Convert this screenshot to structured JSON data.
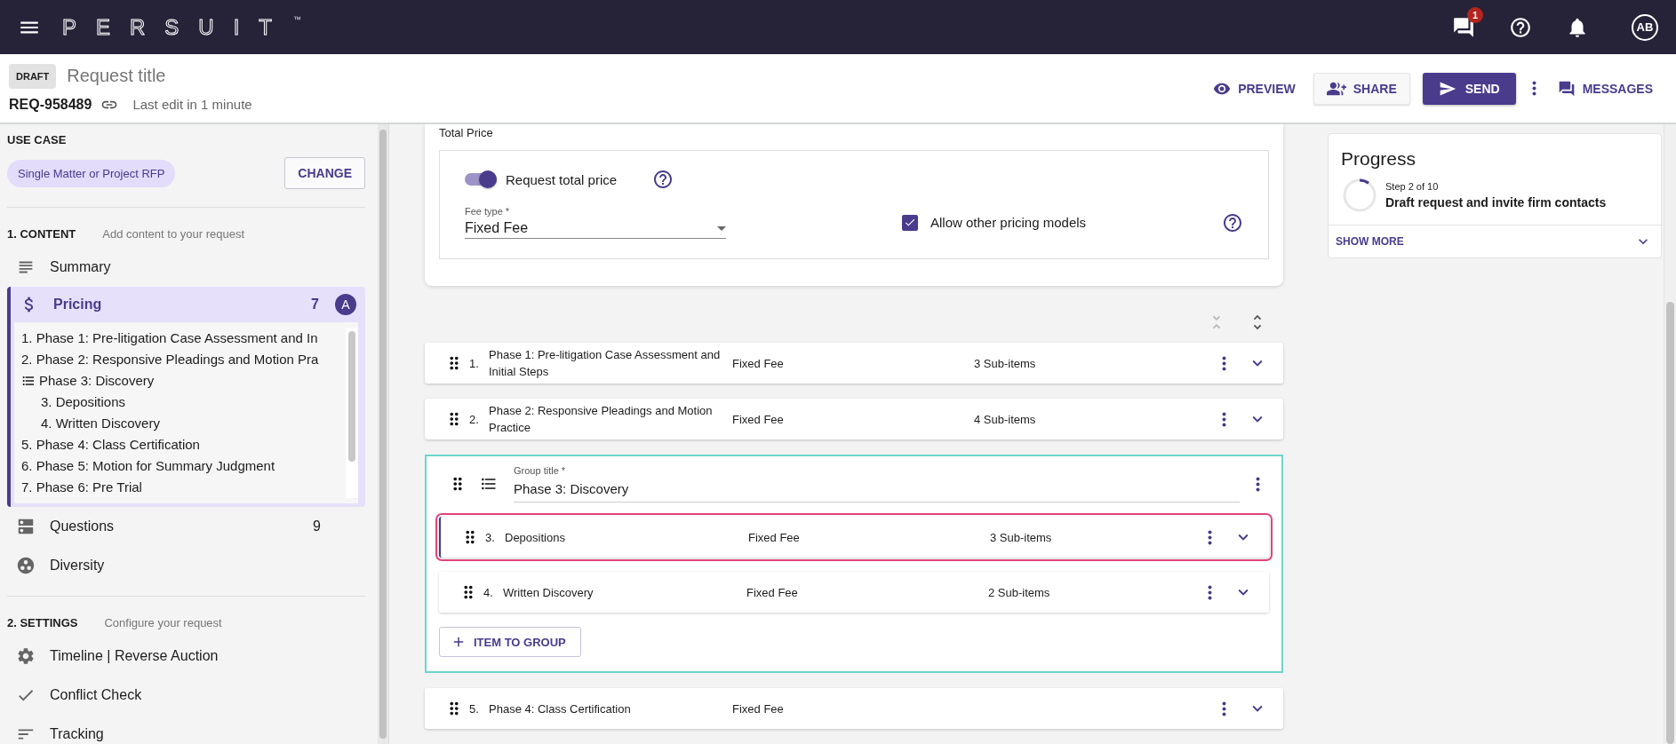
{
  "topbar": {
    "logo": "PERSUIT",
    "trademark": "™",
    "notification_count": "1",
    "avatar": "AB"
  },
  "header": {
    "status": "DRAFT",
    "title_placeholder": "Request title",
    "request_id": "REQ-958489",
    "last_edit": "Last edit in 1 minute",
    "preview": "PREVIEW",
    "share": "SHARE",
    "send": "SEND",
    "messages": "MESSAGES"
  },
  "sidebar": {
    "use_case": {
      "heading": "USE CASE",
      "value": "Single Matter or Project RFP",
      "button": "CHANGE"
    },
    "sections": [
      {
        "title": "1. CONTENT",
        "hint": "Add content to your request",
        "items": [
          {
            "kind": "summary",
            "label": "Summary",
            "selected": false
          },
          {
            "kind": "pricing",
            "label": "Pricing",
            "count": "7",
            "badge": "A",
            "selected": true,
            "children": [
              {
                "kind": "item",
                "label": "1. Phase 1: Pre-litigation Case Assessment and In"
              },
              {
                "kind": "item",
                "label": "2. Phase 2: Responsive Pleadings and Motion Pra"
              },
              {
                "kind": "group",
                "label": "Phase 3: Discovery",
                "children": [
                  {
                    "kind": "item",
                    "label": "3. Depositions"
                  },
                  {
                    "kind": "item",
                    "label": "4. Written Discovery"
                  }
                ]
              },
              {
                "kind": "item",
                "label": "5. Phase 4: Class Certification"
              },
              {
                "kind": "item",
                "label": "6. Phase 5: Motion for Summary Judgment"
              },
              {
                "kind": "item",
                "label": "7. Phase 6: Pre Trial"
              }
            ]
          },
          {
            "kind": "questions",
            "label": "Questions",
            "count": "9",
            "selected": false
          },
          {
            "kind": "diversity",
            "label": "Diversity",
            "selected": false
          }
        ]
      },
      {
        "title": "2. SETTINGS",
        "hint": "Configure your request",
        "items": [
          {
            "kind": "timeline",
            "label": "Timeline | Reverse Auction",
            "selected": false
          },
          {
            "kind": "conflict",
            "label": "Conflict Check",
            "selected": false
          },
          {
            "kind": "tracking",
            "label": "Tracking",
            "selected": false
          }
        ]
      }
    ]
  },
  "total_price": {
    "heading": "Total Price",
    "toggle": {
      "label": "Request total price",
      "on": true
    },
    "fee_type": {
      "label": "Fee type *",
      "value": "Fixed Fee"
    },
    "allow_other": {
      "label": "Allow other pricing models",
      "checked": true
    }
  },
  "items": [
    {
      "kind": "item",
      "number": "1.",
      "title": "Phase 1: Pre-litigation Case Assessment and Initial Steps",
      "fee": "Fixed Fee",
      "sub_items": "3 Sub-items",
      "selected": false
    },
    {
      "kind": "item",
      "number": "2.",
      "title": "Phase 2: Responsive Pleadings and Motion Practice",
      "fee": "Fixed Fee",
      "sub_items": "4 Sub-items",
      "selected": false
    },
    {
      "kind": "group",
      "label": "Group title *",
      "title": "Phase 3: Discovery",
      "button": "ITEM TO GROUP",
      "children": [
        {
          "kind": "item",
          "number": "3.",
          "title": "Depositions",
          "fee": "Fixed Fee",
          "sub_items": "3 Sub-items",
          "selected": true
        },
        {
          "kind": "item",
          "number": "4.",
          "title": "Written Discovery",
          "fee": "Fixed Fee",
          "sub_items": "2 Sub-items",
          "selected": false
        }
      ]
    },
    {
      "kind": "item",
      "number": "5.",
      "title": "Phase 4: Class Certification",
      "fee": "Fixed Fee",
      "selected": false
    }
  ],
  "progress": {
    "title": "Progress",
    "step": "Step 2 of 10",
    "level": 0.1,
    "stage": "Draft request and invite firm contacts",
    "show_more": "SHOW MORE"
  }
}
